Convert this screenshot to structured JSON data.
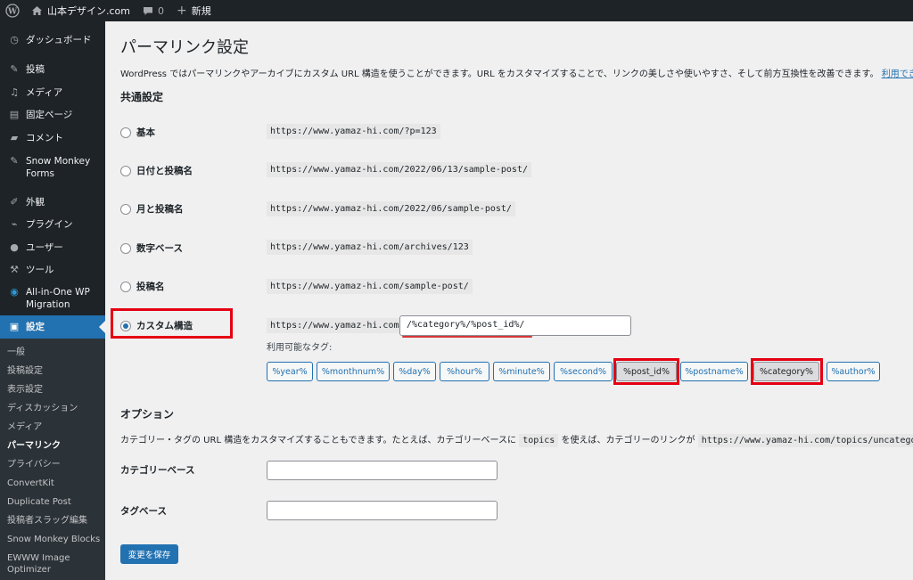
{
  "adminbar": {
    "wp_logo_icon": "wordpress-icon",
    "site_name": "山本デザイン.com",
    "comments_count": "0",
    "new_label": "新規"
  },
  "sidebar": {
    "items": [
      {
        "label": "ダッシュボード",
        "icon": "dashboard-icon"
      },
      {
        "label": "投稿",
        "icon": "pin-icon"
      },
      {
        "label": "メディア",
        "icon": "media-icon"
      },
      {
        "label": "固定ページ",
        "icon": "page-icon"
      },
      {
        "label": "コメント",
        "icon": "comment-icon"
      },
      {
        "label": "Snow Monkey Forms",
        "icon": "pin-icon"
      },
      {
        "label": "外観",
        "icon": "brush-icon"
      },
      {
        "label": "プラグイン",
        "icon": "plugin-icon"
      },
      {
        "label": "ユーザー",
        "icon": "user-icon"
      },
      {
        "label": "ツール",
        "icon": "wrench-icon"
      },
      {
        "label": "All-in-One WP Migration",
        "icon": "migration-icon"
      },
      {
        "label": "設定",
        "icon": "settings-icon"
      }
    ],
    "submenu": [
      "一般",
      "投稿設定",
      "表示設定",
      "ディスカッション",
      "メディア",
      "パーマリンク",
      "プライバシー",
      "ConvertKit",
      "Duplicate Post",
      "投稿者スラッグ編集",
      "Snow Monkey Blocks",
      "EWWW Image Optimizer"
    ],
    "active_submenu": "パーマリンク"
  },
  "main": {
    "title": "パーマリンク設定",
    "intro": "WordPress ではパーマリンクやアーカイブにカスタム URL 構造を使うことができます。URL をカスタマイズすることで、リンクの美しさや使いやすさ、そして前方互換性を改善できます。",
    "intro_link": "利用できるタグは",
    "common_heading": "共通設定",
    "options": [
      {
        "label": "基本",
        "example": "https://www.yamaz-hi.com/?p=123",
        "checked": false
      },
      {
        "label": "日付と投稿名",
        "example": "https://www.yamaz-hi.com/2022/06/13/sample-post/",
        "checked": false
      },
      {
        "label": "月と投稿名",
        "example": "https://www.yamaz-hi.com/2022/06/sample-post/",
        "checked": false
      },
      {
        "label": "数字ベース",
        "example": "https://www.yamaz-hi.com/archives/123",
        "checked": false
      },
      {
        "label": "投稿名",
        "example": "https://www.yamaz-hi.com/sample-post/",
        "checked": false
      },
      {
        "label": "カスタム構造",
        "example": "https://www.yamaz-hi.com",
        "checked": true
      }
    ],
    "custom_structure_value": "/%category%/%post_id%/",
    "available_tags_label": "利用可能なタグ:",
    "tags": [
      {
        "label": "%year%",
        "selected": false
      },
      {
        "label": "%monthnum%",
        "selected": false
      },
      {
        "label": "%day%",
        "selected": false
      },
      {
        "label": "%hour%",
        "selected": false
      },
      {
        "label": "%minute%",
        "selected": false
      },
      {
        "label": "%second%",
        "selected": false
      },
      {
        "label": "%post_id%",
        "selected": true
      },
      {
        "label": "%postname%",
        "selected": false
      },
      {
        "label": "%category%",
        "selected": true
      },
      {
        "label": "%author%",
        "selected": false
      }
    ],
    "options_heading": "オプション",
    "options_text_1": "カテゴリー・タグの URL 構造をカスタマイズすることもできます。たとえば、カテゴリーベースに",
    "options_text_code1": "topics",
    "options_text_2": "を使えば、カテゴリーのリンクが",
    "options_text_code2": "https://www.yamaz-hi.com/topics/uncategorized/",
    "category_base_label": "カテゴリーベース",
    "category_base_value": "",
    "tag_base_label": "タグベース",
    "tag_base_value": "",
    "save_label": "変更を保存"
  },
  "colors": {
    "accent": "#2271b1",
    "highlight_red": "#e50012",
    "sidebar_bg": "#1d2327"
  }
}
